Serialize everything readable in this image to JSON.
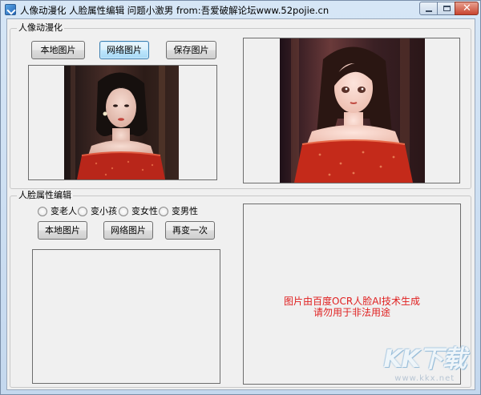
{
  "window": {
    "title": "人像动漫化 人脸属性编辑 问题小激男 from:吾爱破解论坛www.52pojie.cn"
  },
  "portrait_section": {
    "legend": "人像动漫化",
    "buttons": {
      "local_image": "本地图片",
      "network_image": "网络图片",
      "save_image": "保存图片"
    }
  },
  "face_section": {
    "legend": "人脸属性编辑",
    "options": [
      "变老人",
      "变小孩",
      "变女性",
      "变男性"
    ],
    "buttons": {
      "local_image": "本地图片",
      "network_image": "网络图片",
      "retry": "再变一次"
    },
    "notice_line1": "图片由百度OCR人脸AI技术生成",
    "notice_line2": "请勿用于非法用途"
  },
  "watermark": {
    "logo": "KK下载",
    "url": "www.kkx.net"
  },
  "colors": {
    "notice_text": "#e02020",
    "dress_red": "#c0281c",
    "background": "#f0f0f0"
  }
}
